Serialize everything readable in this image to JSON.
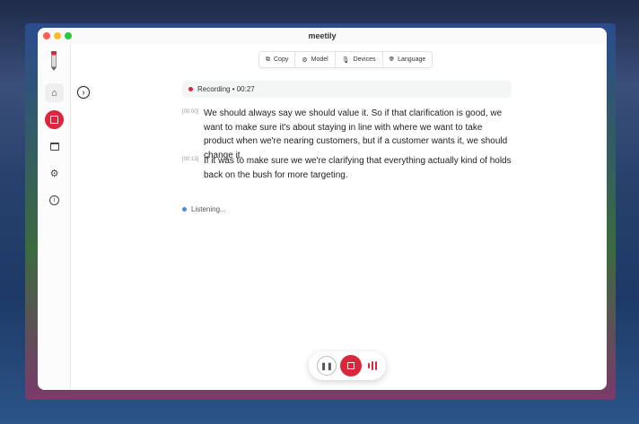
{
  "window": {
    "title": "meetily"
  },
  "colors": {
    "accent": "#d9283c",
    "listening": "#4a8ae0"
  },
  "sidebar": {
    "items": [
      {
        "icon": "home-icon"
      },
      {
        "icon": "record-stop-icon"
      },
      {
        "icon": "calendar-icon"
      },
      {
        "icon": "gear-icon"
      },
      {
        "icon": "info-icon"
      }
    ]
  },
  "toolbar": {
    "copy": "Copy",
    "model": "Model",
    "devices": "Devices",
    "language": "Language"
  },
  "recording": {
    "label": "Recording • 00:27"
  },
  "transcript": [
    {
      "time": "[00:00]",
      "text": "We should always say we should value it. So if that clarification is good, we want to make sure it's about staying in line with where we want to take product when we're nearing customers, but if a customer wants it, we should change it."
    },
    {
      "time": "[00:13]",
      "text": "If it was to make sure we we're clarifying that everything actually kind of holds back on the bush for more targeting."
    }
  ],
  "status": {
    "listening": "Listening..."
  }
}
